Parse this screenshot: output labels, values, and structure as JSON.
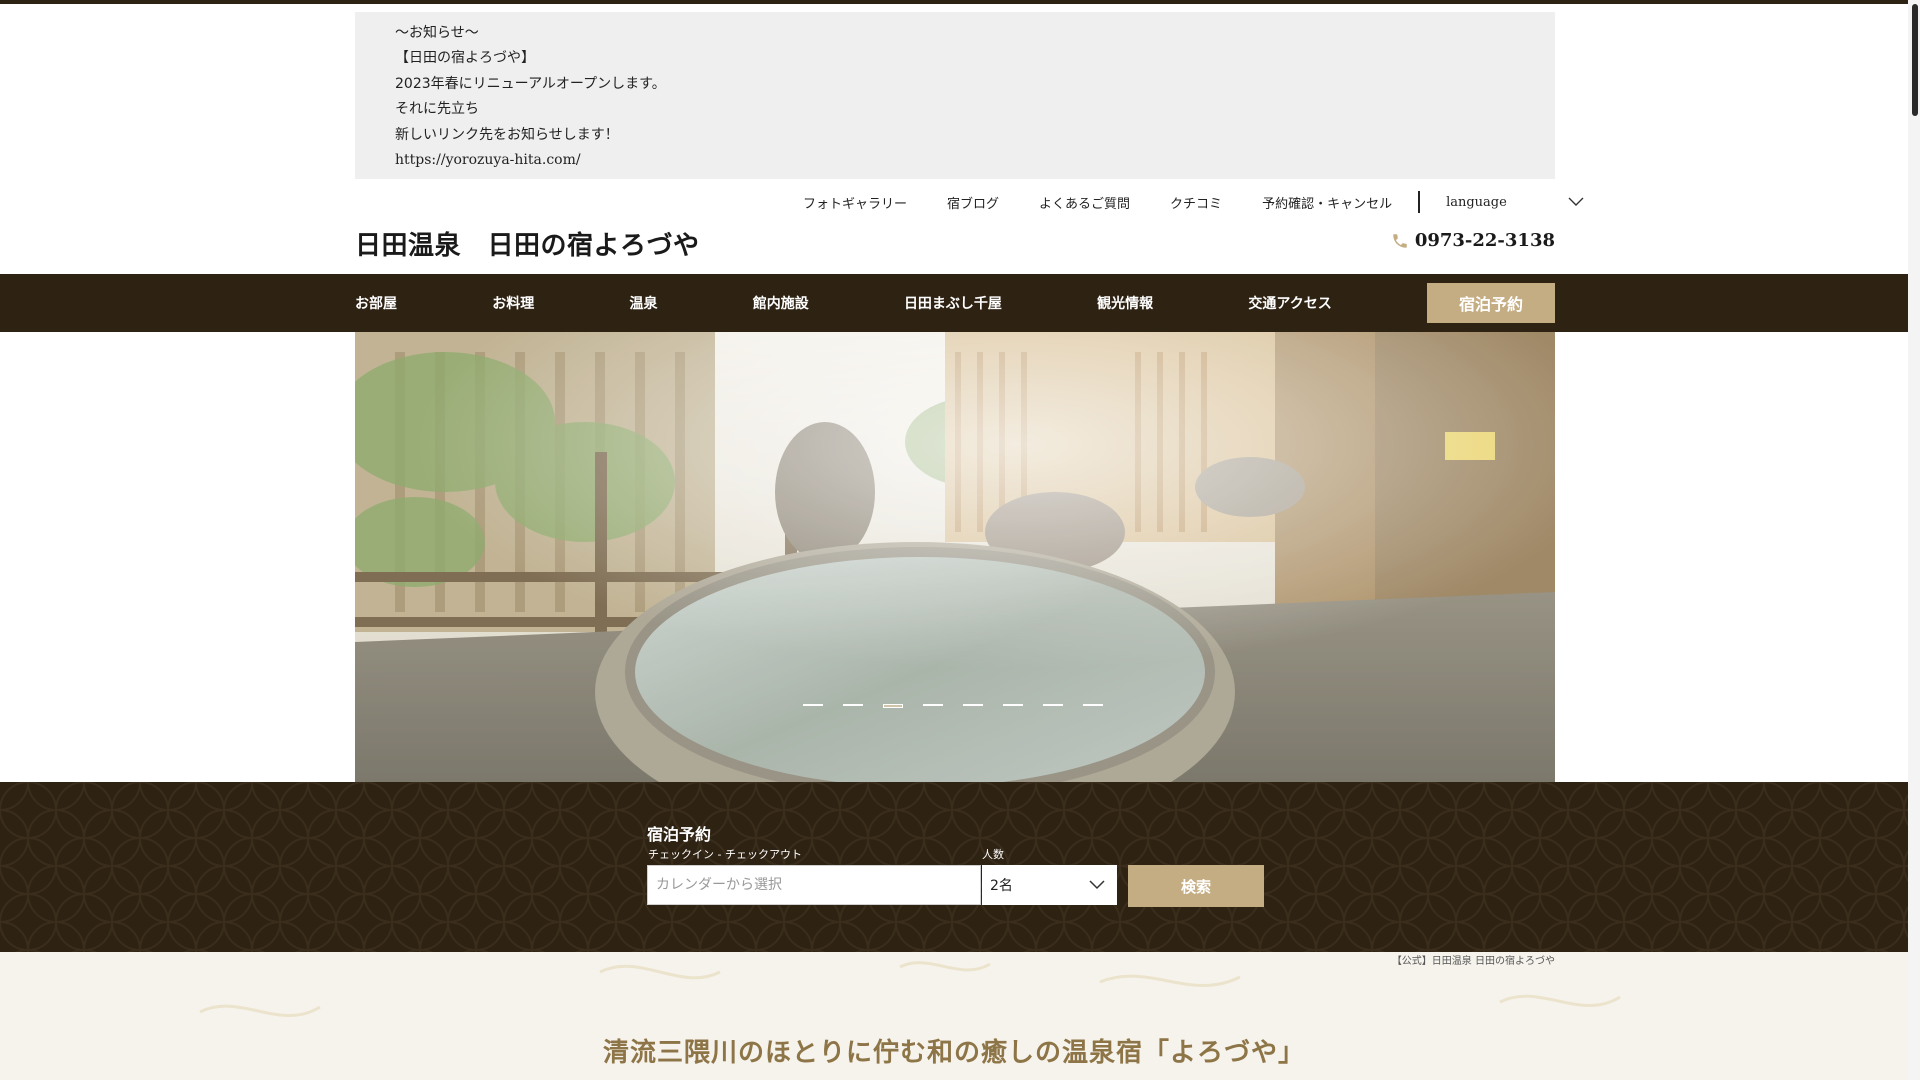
{
  "notice": {
    "lines": [
      "〜お知らせ〜",
      "【日田の宿よろづや】",
      "2023年春にリニューアルオープンします。",
      "それに先立ち",
      "新しいリンク先をお知らせします！"
    ],
    "url": "https://yorozuya-hita.com/"
  },
  "util_nav": {
    "items": [
      "フォトギャラリー",
      "宿ブログ",
      "よくあるご質問",
      "クチコミ",
      "予約確認・キャンセル"
    ],
    "language_label": "language"
  },
  "header": {
    "site_title": "日田温泉　日田の宿よろづや",
    "phone": "0973-22-3138"
  },
  "main_nav": {
    "items": [
      "お部屋",
      "お料理",
      "温泉",
      "館内施設",
      "日田まぶし千屋",
      "観光情報",
      "交通アクセス"
    ],
    "reserve_label": "宿泊予約"
  },
  "hero": {
    "slide_count": 8,
    "active_slide": 3
  },
  "booking": {
    "title": "宿泊予約",
    "date_label": "チェックイン - チェックアウト",
    "date_placeholder": "カレンダーから選択",
    "guests_label": "人数",
    "guests_value": "2名",
    "search_label": "検索"
  },
  "breadcrumb": "【公式】日田温泉 日田の宿よろづや",
  "tagline": "清流三隈川のほとりに佇む和の癒しの温泉宿「よろづや」",
  "colors": {
    "dark_brown": "#2e2213",
    "gold": "#c5ad83",
    "tagline": "#8d7547",
    "notice_bg": "#efefef"
  },
  "icons": {
    "phone": "phone-icon",
    "language_caret": "chevron-down-icon",
    "guests_caret": "chevron-down-icon"
  }
}
